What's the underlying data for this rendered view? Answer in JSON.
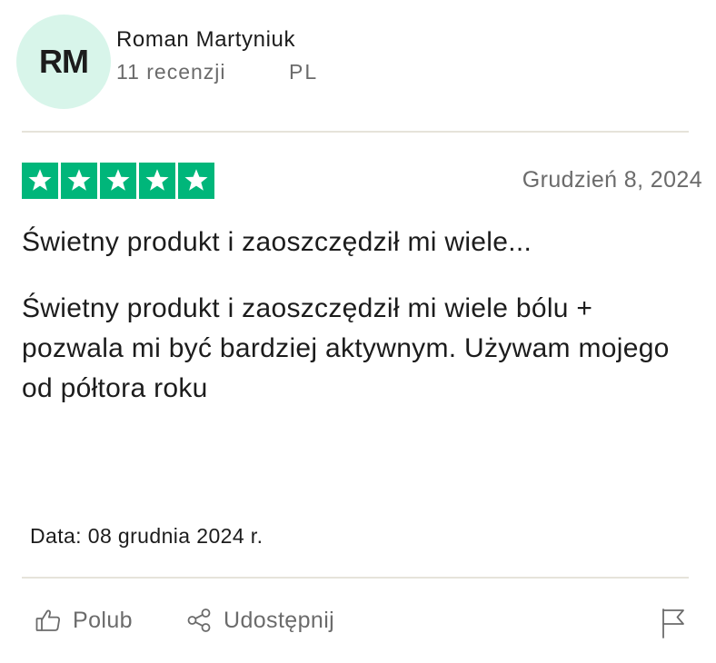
{
  "reviewer": {
    "initials": "RM",
    "avatar_color": "#d8f5ea",
    "name": "Roman Martyniuk",
    "review_count": "11 recenzji",
    "country": "PL"
  },
  "review": {
    "rating": 5,
    "rating_max": 5,
    "star_color": "#00b67a",
    "date": "Grudzień 8, 2024",
    "title": "Świetny produkt i zaoszczędził mi wiele...",
    "body": "Świetny produkt i zaoszczędził mi wiele bólu + pozwala mi być bardziej aktywnym. Używam mojego od półtora roku",
    "experience_date": "Data: 08 grudnia 2024 r."
  },
  "actions": {
    "like_label": "Polub",
    "like_icon": "thumbs-up-icon",
    "share_label": "Udostępnij",
    "share_icon": "share-icon",
    "report_icon": "flag-icon"
  }
}
